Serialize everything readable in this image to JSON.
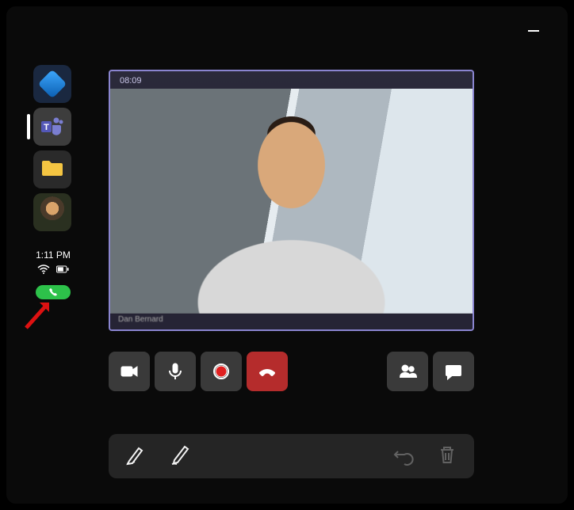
{
  "sidebar": {
    "apps": [
      {
        "name": "dynamics"
      },
      {
        "name": "teams",
        "active": true
      },
      {
        "name": "files"
      },
      {
        "name": "avatar"
      }
    ]
  },
  "status": {
    "time": "1:11 PM"
  },
  "call": {
    "duration": "08:09",
    "participant_name": "Dan Bernard"
  },
  "controls": {
    "camera": "camera",
    "mic": "microphone",
    "record": "record",
    "end": "end-call",
    "people": "people",
    "chat": "chat"
  },
  "ink": {
    "marker": "marker",
    "pen": "pen",
    "undo": "undo",
    "delete": "delete"
  }
}
